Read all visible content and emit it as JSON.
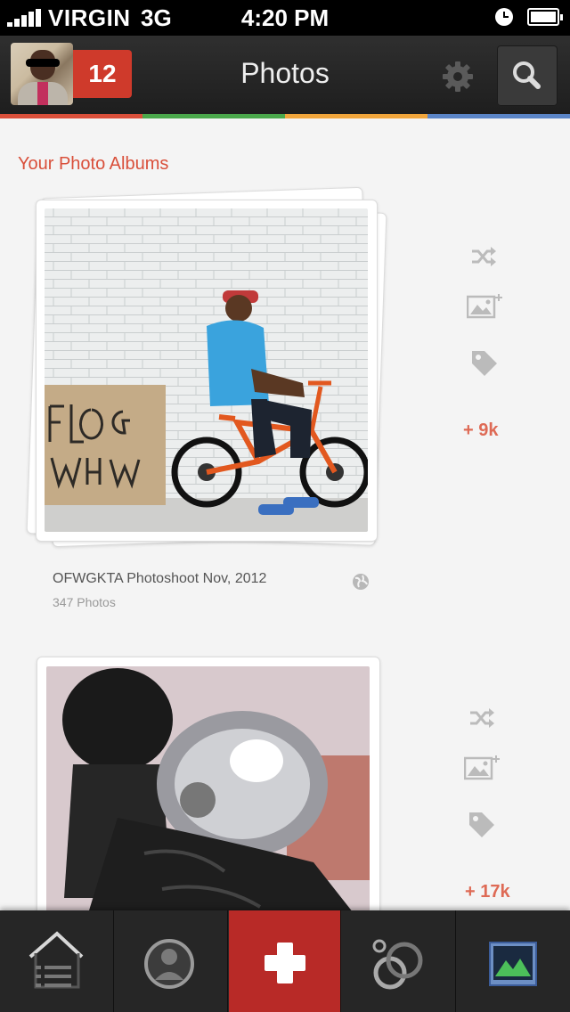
{
  "status_bar": {
    "carrier": "VIRGIN",
    "network": "3G",
    "time": "4:20 PM"
  },
  "navbar": {
    "title": "Photos",
    "notification_count": "12",
    "avatar": "profile-avatar"
  },
  "colors": {
    "red": "#d94f3a",
    "green": "#4aa84b",
    "orange": "#f0a53b",
    "blue": "#5b85c7",
    "accent_text": "#de6a55"
  },
  "section_title": "Your Photo Albums",
  "albums": [
    {
      "name": "OFWGKTA Photoshoot Nov, 2012",
      "count": "347 Photos",
      "plus": "+ 9k",
      "actions": [
        "shuffle-icon",
        "add-photo-icon",
        "tag-icon"
      ]
    },
    {
      "name": "",
      "count": "",
      "plus": "+ 17k",
      "actions": [
        "shuffle-icon",
        "add-photo-icon",
        "tag-icon"
      ]
    }
  ],
  "tabbar": {
    "tabs": [
      "home-feed-icon",
      "profile-icon",
      "add-icon",
      "circles-icon",
      "photos-icon"
    ],
    "active": "add-icon"
  }
}
